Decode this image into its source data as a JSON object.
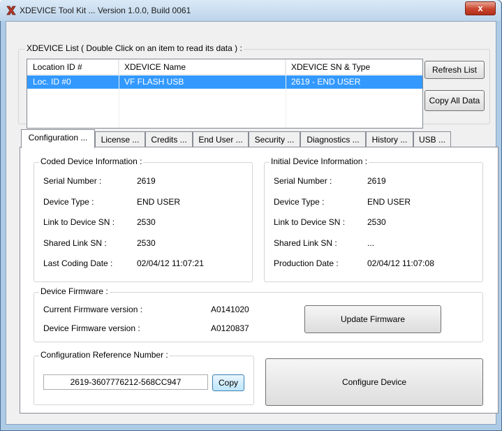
{
  "window": {
    "title": "XDEVICE Tool Kit ... Version 1.0.0, Build 0061",
    "close_label": "x"
  },
  "device_list": {
    "group_title": "XDEVICE List ( Double Click on an item to read its data ) :",
    "columns": [
      "Location ID #",
      "XDEVICE Name",
      "XDEVICE SN & Type"
    ],
    "rows": [
      {
        "location": "Loc. ID #0",
        "name": "VF FLASH USB",
        "sn_type": "2619 - END USER"
      }
    ],
    "refresh_label": "Refresh List",
    "copy_all_label": "Copy All Data"
  },
  "tabs": [
    "Configuration ...",
    "License ...",
    "Credits ...",
    "End User ...",
    "Security ...",
    "Diagnostics ...",
    "History ...",
    "USB ..."
  ],
  "coded": {
    "title": "Coded Device Information :",
    "rows": [
      {
        "label": "Serial Number :",
        "value": "2619"
      },
      {
        "label": "Device Type :",
        "value": "END USER"
      },
      {
        "label": "Link to Device SN :",
        "value": "2530"
      },
      {
        "label": "Shared Link SN :",
        "value": "2530"
      },
      {
        "label": "Last Coding Date :",
        "value": "02/04/12 11:07:21"
      }
    ]
  },
  "initial": {
    "title": "Initial Device Information :",
    "rows": [
      {
        "label": "Serial Number :",
        "value": "2619"
      },
      {
        "label": "Device Type :",
        "value": "END USER"
      },
      {
        "label": "Link to Device SN :",
        "value": "2530"
      },
      {
        "label": "Shared Link SN :",
        "value": "..."
      },
      {
        "label": "Production Date :",
        "value": "02/04/12 11:07:08"
      }
    ]
  },
  "firmware": {
    "title": "Device Firmware :",
    "current_label": "Current Firmware version :",
    "current_value": "A0141020",
    "device_label": "Device Firmware version :",
    "device_value": "A0120837",
    "update_label": "Update Firmware"
  },
  "config_ref": {
    "title": "Configuration Reference Number :",
    "value": "2619-3607776212-568CC947",
    "copy_label": "Copy"
  },
  "configure_label": "Configure Device"
}
